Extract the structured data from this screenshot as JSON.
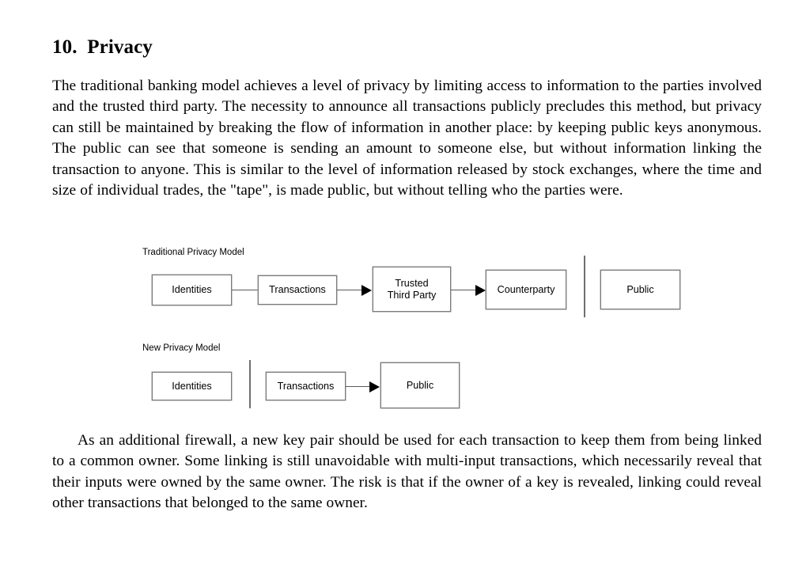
{
  "document": {
    "heading": "10.  Privacy",
    "paragraph_1": "The traditional banking model achieves a level of privacy by limiting access to information to the parties involved and the trusted third party.  The necessity to announce all transactions publicly precludes this method, but privacy can still be maintained by breaking the flow of information in another place: by keeping public keys anonymous.  The public can see that someone is sending an amount to someone else, but without information linking the transaction to anyone.  This is similar to the level of information released by stock exchanges, where the time and size of individual trades, the \"tape\", is made public, but without telling who the parties were.",
    "paragraph_2": "As an additional firewall, a new key pair should be used for each transaction to keep them from being linked to a common owner.  Some linking is still unavoidable with multi-input transactions, which necessarily reveal that their inputs were owned by the same owner.  The risk is that if the owner of a key is revealed, linking could reveal other transactions that belonged to the same owner."
  },
  "diagrams": [
    {
      "caption": "Traditional Privacy Model",
      "nodes": [
        {
          "label": "Identities"
        },
        {
          "label": "Transactions"
        },
        {
          "label_line_1": "Trusted",
          "label_line_2": "Third Party"
        },
        {
          "label": "Counterparty"
        },
        {
          "label": "Public"
        }
      ]
    },
    {
      "caption": "New Privacy Model",
      "nodes": [
        {
          "label": "Identities"
        },
        {
          "label": "Transactions"
        },
        {
          "label": "Public"
        }
      ]
    }
  ],
  "colors": {
    "background": "#ffffff",
    "text": "#000000",
    "node_border": "#7a7a7a",
    "connector": "#5a5a5a",
    "arrow": "#000000",
    "divider": "#6f6f6f"
  }
}
